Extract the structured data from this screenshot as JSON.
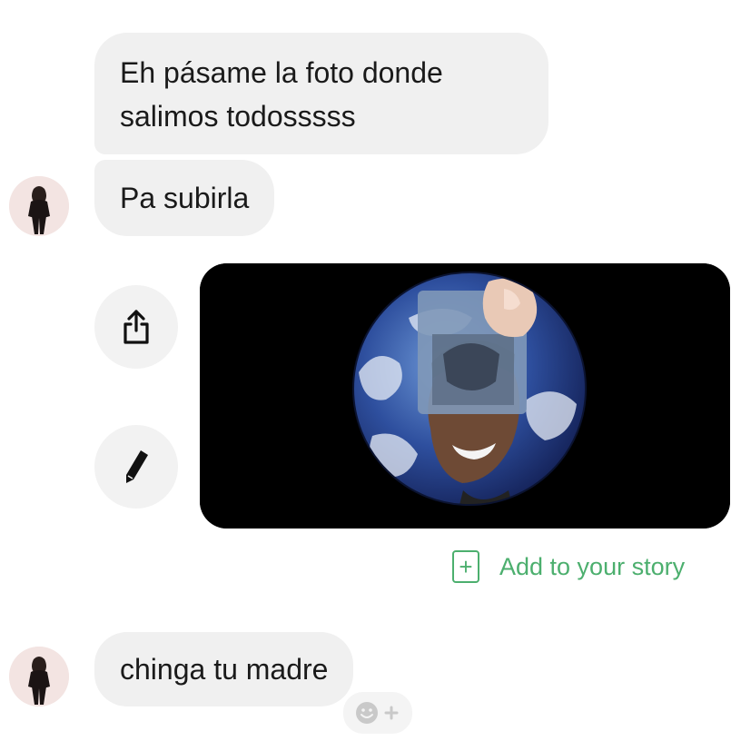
{
  "messages": [
    {
      "text": "Eh pásame la foto donde salimos todosssss"
    },
    {
      "text": "Pa subirla"
    },
    {
      "text": "chinga tu madre"
    }
  ],
  "story": {
    "label": "Add to your story",
    "plus": "+"
  },
  "icons": {
    "share": "share-icon",
    "edit": "pencil-icon",
    "react": "add-reaction-icon"
  },
  "colors": {
    "bubble": "#f0f0f0",
    "story_green": "#4caf6e",
    "image_bg": "#000000"
  }
}
